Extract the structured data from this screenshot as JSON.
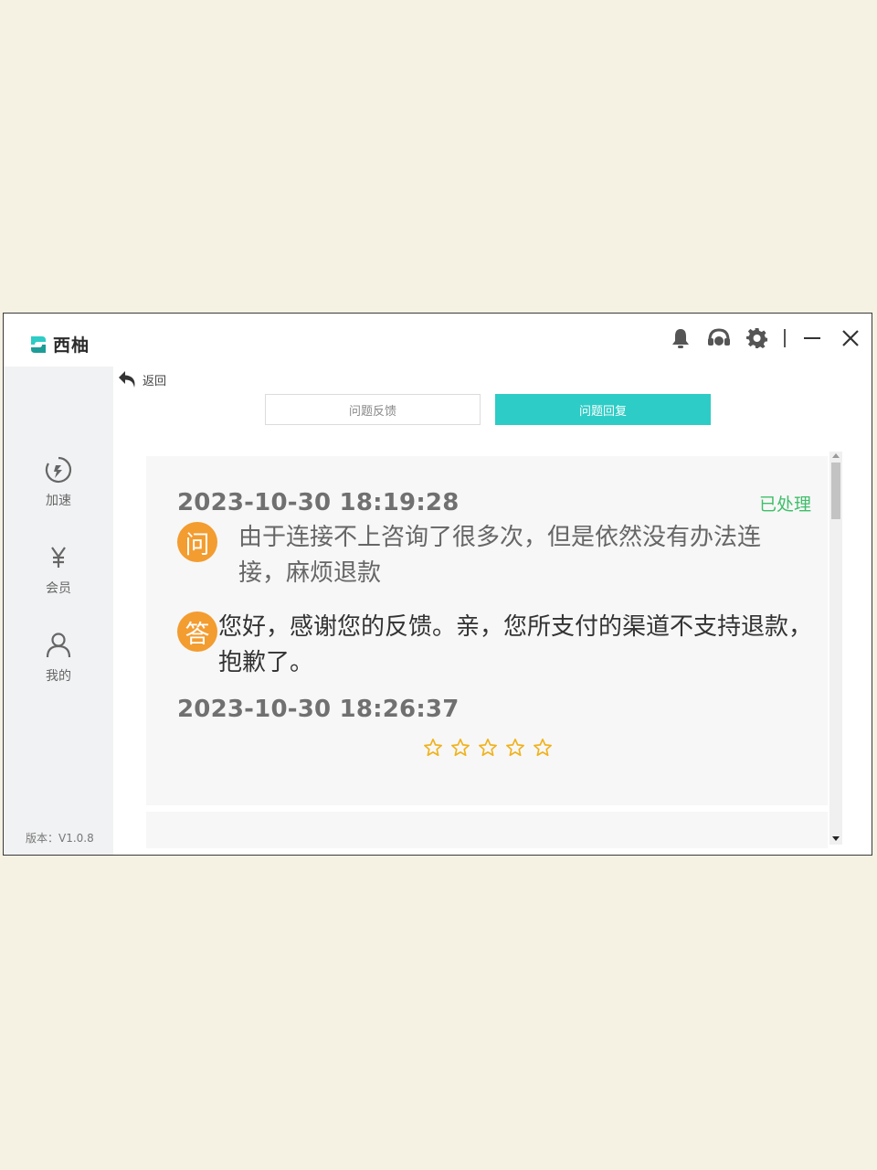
{
  "app": {
    "brand": "西柚",
    "brand_color": "#2dccc6"
  },
  "titlebar": {
    "icons": [
      "bell-icon",
      "headset-icon",
      "gear-icon",
      "minimize-icon",
      "close-icon"
    ]
  },
  "sidebar": {
    "items": [
      {
        "label": "加速",
        "icon": "speed-icon"
      },
      {
        "label": "会员",
        "icon": "yen-icon"
      },
      {
        "label": "我的",
        "icon": "user-icon"
      }
    ],
    "version": "版本：V1.0.8"
  },
  "back": {
    "label": "返回"
  },
  "tabs": [
    {
      "label": "问题反馈",
      "active": false
    },
    {
      "label": "问题回复",
      "active": true
    }
  ],
  "ticket": {
    "question_time": "2023-10-30 18:19:28",
    "status": "已处理",
    "question_badge": "问",
    "question": "由于连接不上咨询了很多次，但是依然没有办法连接，麻烦退款",
    "answer_badge": "答",
    "answer": "您好，感谢您的反馈。亲，您所支付的渠道不支持退款，抱歉了。",
    "answer_time": "2023-10-30 18:26:37",
    "rating": {
      "value": 0,
      "max": 5
    }
  },
  "colors": {
    "badge": "#f39c30",
    "status": "#3fbf6a",
    "star": "#f0b21c"
  }
}
